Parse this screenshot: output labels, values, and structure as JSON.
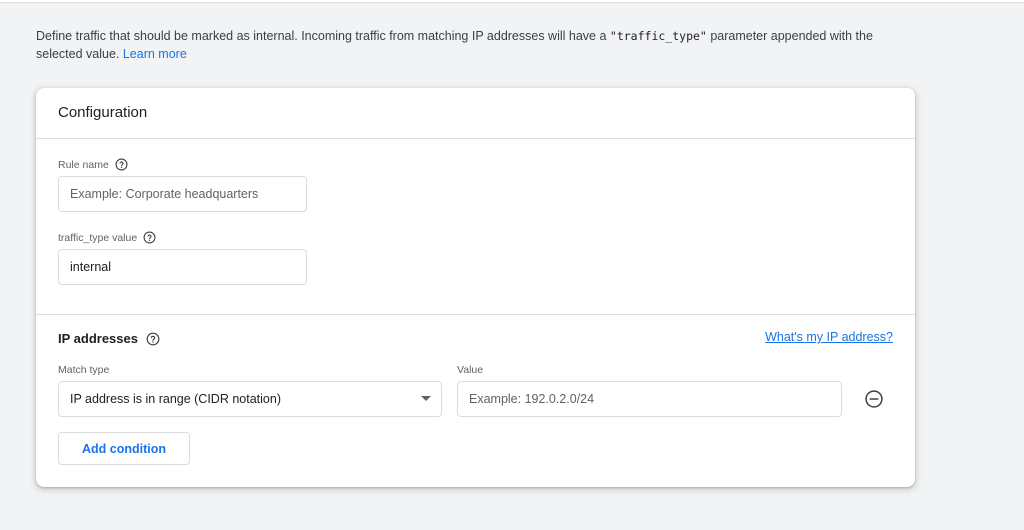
{
  "intro": {
    "text_before": "Define traffic that should be marked as internal. Incoming traffic from matching IP addresses will have a ",
    "code": "\"traffic_type\"",
    "text_after": " parameter appended with the selected value. ",
    "learn_more": "Learn more"
  },
  "card": {
    "title": "Configuration",
    "rule_name": {
      "label": "Rule name",
      "placeholder": "Example: Corporate headquarters",
      "value": ""
    },
    "traffic_type": {
      "label": "traffic_type value",
      "value": "internal"
    },
    "ip_addresses": {
      "title": "IP addresses",
      "whats_my_ip": "What's my IP address?",
      "match_type_label": "Match type",
      "match_type_selected": "IP address is in range (CIDR notation)",
      "value_label": "Value",
      "value_placeholder": "Example: 192.0.2.0/24",
      "add_condition": "Add condition"
    }
  },
  "colors": {
    "accent": "#1a73e8",
    "background": "#f1f3f4",
    "border": "#dadce0"
  },
  "icons": [
    "help-icon",
    "chevron-down-icon",
    "remove-circle-icon"
  ]
}
